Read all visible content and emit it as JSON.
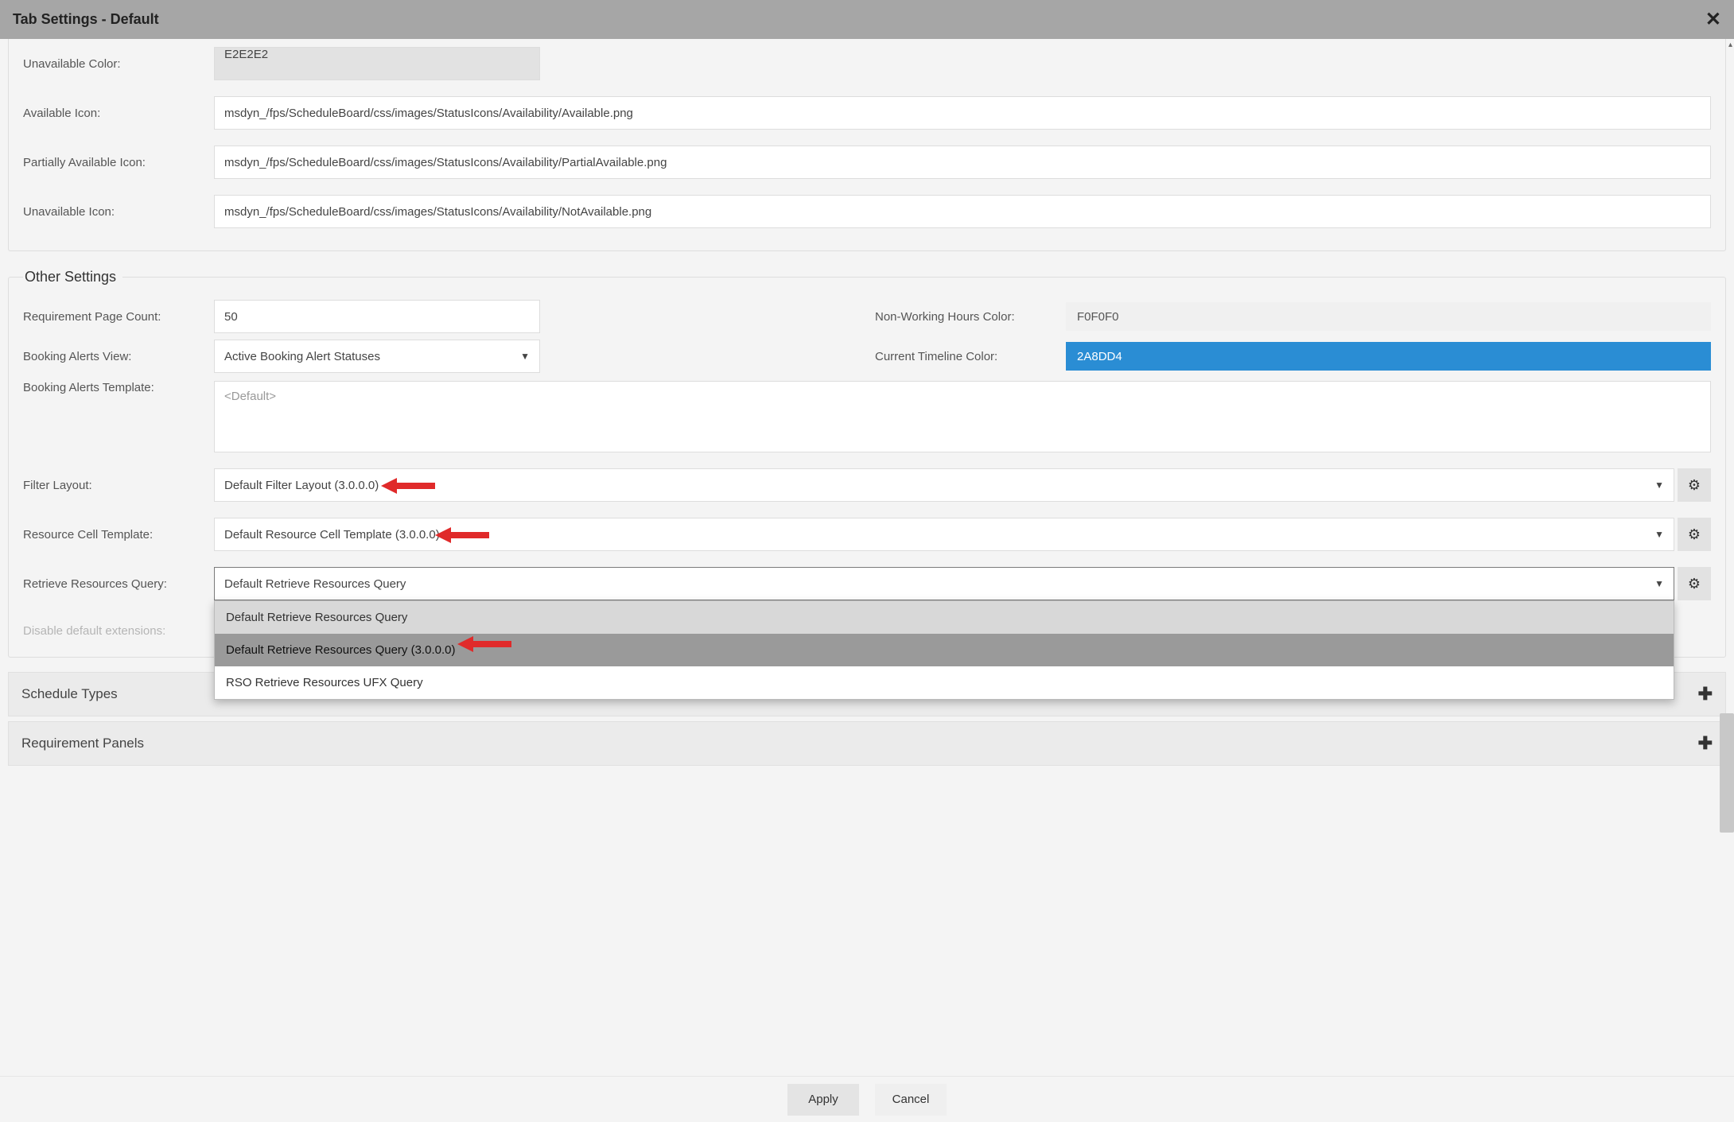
{
  "title": "Tab Settings - Default",
  "top": {
    "unavailable_color_label": "Unavailable Color:",
    "unavailable_color_value": "E2E2E2",
    "available_icon_label": "Available Icon:",
    "available_icon_value": "msdyn_/fps/ScheduleBoard/css/images/StatusIcons/Availability/Available.png",
    "partially_available_icon_label": "Partially Available Icon:",
    "partially_available_icon_value": "msdyn_/fps/ScheduleBoard/css/images/StatusIcons/Availability/PartialAvailable.png",
    "unavailable_icon_label": "Unavailable Icon:",
    "unavailable_icon_value": "msdyn_/fps/ScheduleBoard/css/images/StatusIcons/Availability/NotAvailable.png"
  },
  "other": {
    "legend": "Other Settings",
    "req_page_count_label": "Requirement Page Count:",
    "req_page_count_value": "50",
    "nonworking_label": "Non-Working Hours Color:",
    "nonworking_value": "F0F0F0",
    "booking_alerts_view_label": "Booking Alerts View:",
    "booking_alerts_view_value": "Active Booking Alert Statuses",
    "timeline_label": "Current Timeline Color:",
    "timeline_value": "2A8DD4",
    "booking_alerts_template_label": "Booking Alerts Template:",
    "booking_alerts_template_placeholder": "<Default>",
    "filter_layout_label": "Filter Layout:",
    "filter_layout_value": "Default Filter Layout (3.0.0.0)",
    "resource_cell_label": "Resource Cell Template:",
    "resource_cell_value": "Default Resource Cell Template (3.0.0.0)",
    "retrieve_query_label": "Retrieve Resources Query:",
    "retrieve_query_value": "Default Retrieve Resources Query",
    "retrieve_query_options": [
      "Default Retrieve Resources Query",
      "Default Retrieve Resources Query (3.0.0.0)",
      "RSO Retrieve Resources UFX Query"
    ],
    "disable_ext_label": "Disable default extensions:"
  },
  "accordions": {
    "schedule_types": "Schedule Types",
    "requirement_panels": "Requirement Panels"
  },
  "footer": {
    "apply": "Apply",
    "cancel": "Cancel"
  }
}
